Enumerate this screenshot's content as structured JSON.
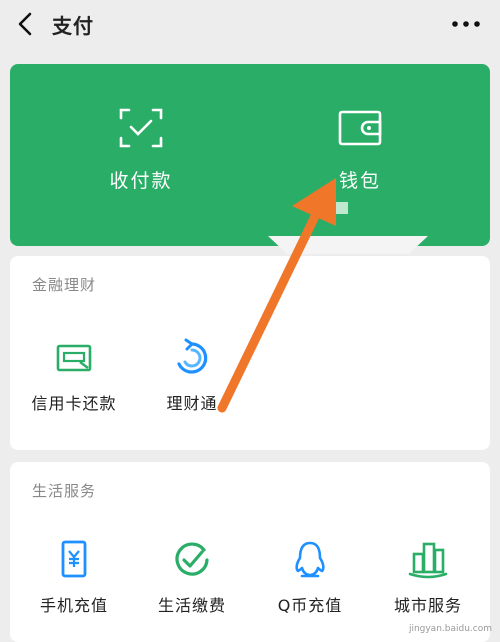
{
  "header": {
    "title": "支付"
  },
  "payments": [
    {
      "label": "收付款",
      "icon": "scan-check-icon"
    },
    {
      "label": "钱包",
      "icon": "wallet-icon"
    }
  ],
  "finance": {
    "title": "金融理财",
    "items": [
      {
        "label": "信用卡还款",
        "icon": "credit-card-icon"
      },
      {
        "label": "理财通",
        "icon": "finance-swirl-icon"
      }
    ]
  },
  "life": {
    "title": "生活服务",
    "items": [
      {
        "label": "手机充值",
        "icon": "phone-yen-icon"
      },
      {
        "label": "生活缴费",
        "icon": "check-circle-icon"
      },
      {
        "label": "Q币充值",
        "icon": "penguin-icon"
      },
      {
        "label": "城市服务",
        "icon": "city-buildings-icon"
      }
    ]
  },
  "watermark": "jingyan.baidu.com",
  "colors": {
    "accent": "#2aae67",
    "annotation_arrow": "#f0762a"
  }
}
